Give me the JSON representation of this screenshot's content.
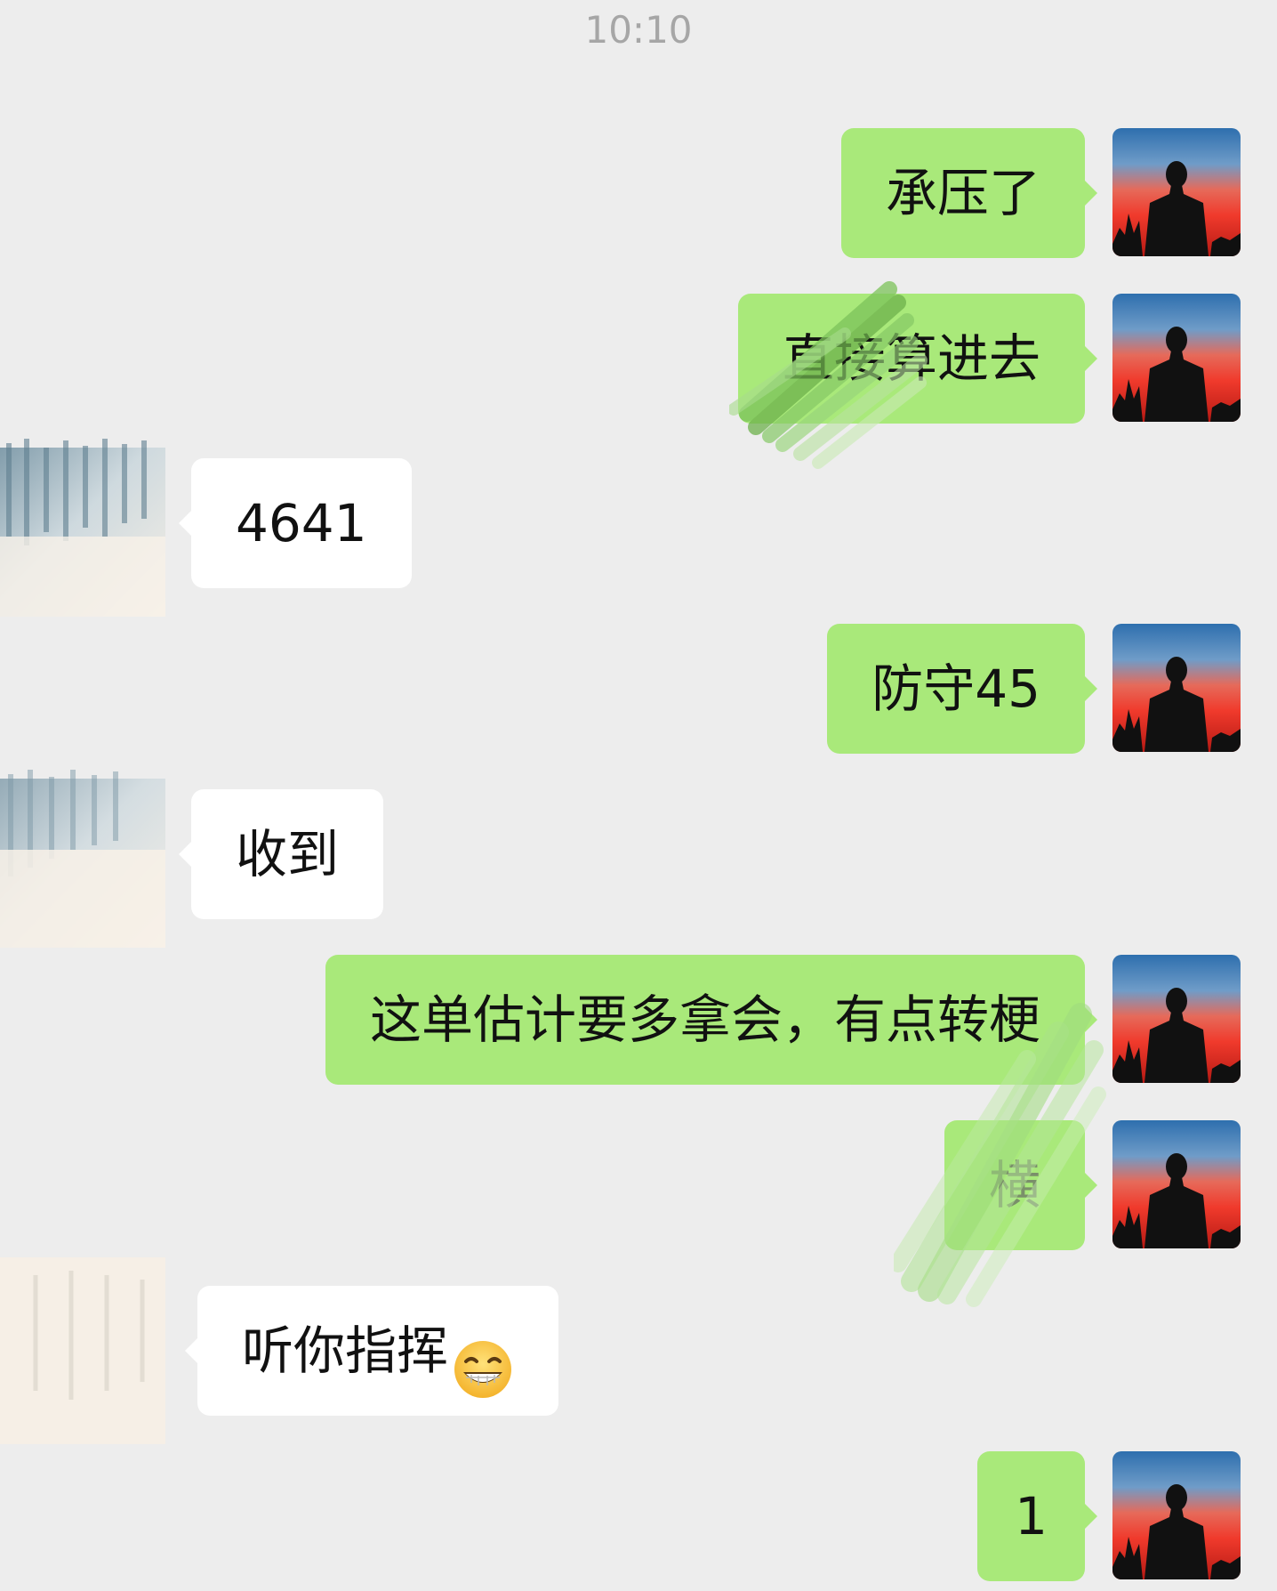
{
  "status": {
    "time": "10:10"
  },
  "messages": [
    {
      "side": "out",
      "text": "承压了"
    },
    {
      "side": "out",
      "text": "直接算进去"
    },
    {
      "side": "in",
      "text": "4641"
    },
    {
      "side": "out",
      "text": "防守45"
    },
    {
      "side": "in",
      "text": "收到"
    },
    {
      "side": "out",
      "text": "这单估计要多拿会，有点转梗"
    },
    {
      "side": "out",
      "text": "横"
    },
    {
      "side": "in",
      "text": "听你指挥",
      "emoji": "grinning-face-emoji"
    },
    {
      "side": "out",
      "text": "1"
    }
  ],
  "colors": {
    "background": "#ededed",
    "outgoing_bubble": "#a9e97a",
    "incoming_bubble": "#ffffff",
    "timestamp_text": "#a6a6a6"
  },
  "icons": {
    "self_avatar": "sunset-silhouette-avatar",
    "contact_avatar": "redacted-contact-avatar"
  }
}
